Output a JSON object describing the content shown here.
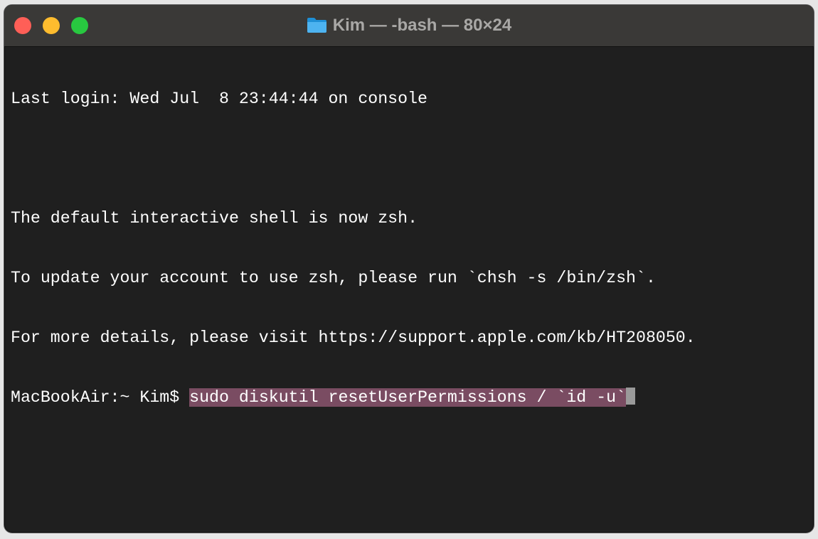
{
  "window": {
    "title": "Kim — -bash — 80×24",
    "title_icon": "folder-icon",
    "colors": {
      "background": "#1f1f1f",
      "titlebar": "#3a3937",
      "close": "#ff5f57",
      "minimize": "#febc2e",
      "zoom": "#28c840",
      "selection": "#7a4c62"
    }
  },
  "terminal": {
    "lines": [
      "Last login: Wed Jul  8 23:44:44 on console",
      "",
      "The default interactive shell is now zsh.",
      "To update your account to use zsh, please run `chsh -s /bin/zsh`.",
      "For more details, please visit https://support.apple.com/kb/HT208050."
    ],
    "prompt": "MacBookAir:~ Kim$ ",
    "command": "sudo diskutil resetUserPermissions / `id -u`"
  }
}
